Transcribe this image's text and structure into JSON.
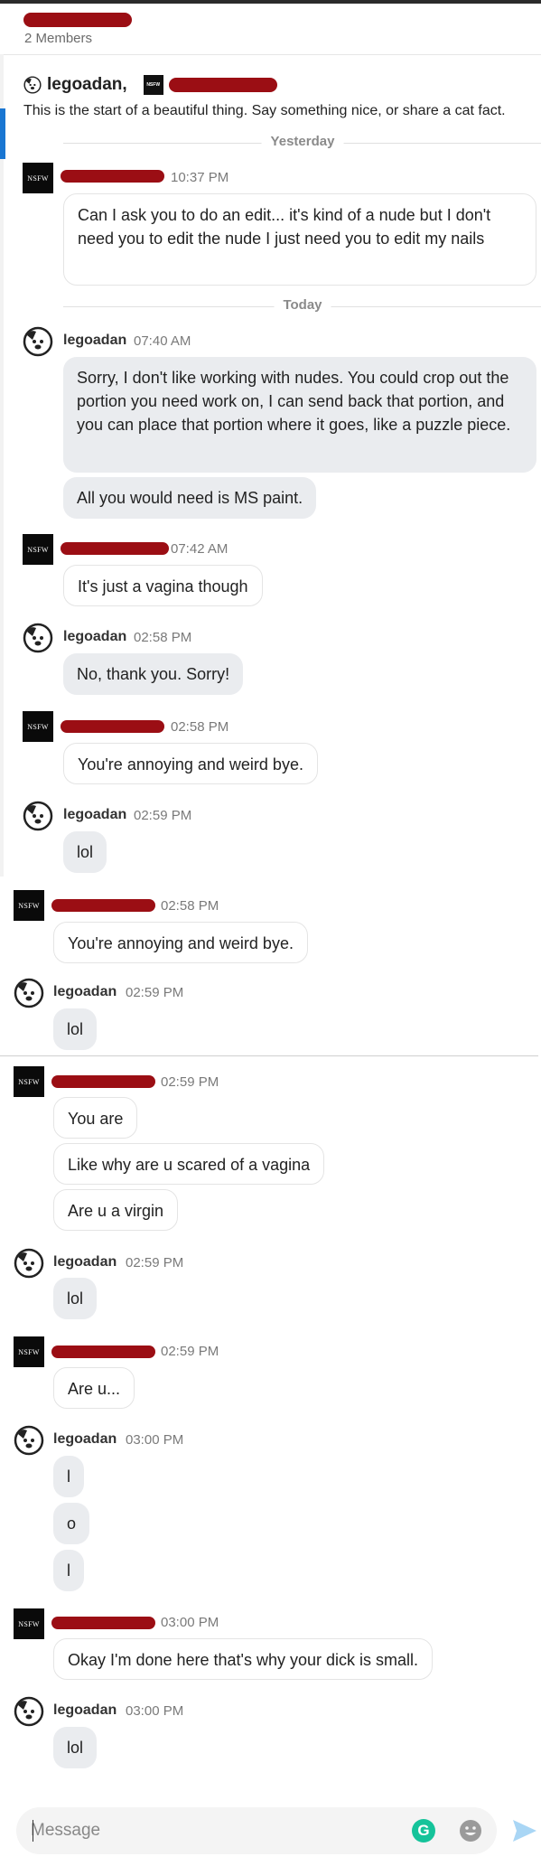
{
  "header": {
    "members": "2 Members",
    "intro_name_1": "legoadan,",
    "intro_text": "This is the start of a beautiful thing. Say something nice, or share a cat fact."
  },
  "icons": {
    "nsfw_avatar": "NSFW",
    "lego_avatar": "dog-face-icon",
    "grammarly": "G",
    "emoji": "emoji-icon",
    "send": "send-icon"
  },
  "dividers": {
    "yesterday": "Yesterday",
    "today": "Today"
  },
  "messages": {
    "m1": {
      "time": "10:37 PM",
      "text": "Can I ask you to do an edit... it's kind of a nude but I don't need you to edit the nude I just need you to edit my nails"
    },
    "m2": {
      "user": "legoadan",
      "time": "07:40 AM",
      "text1": "Sorry, I don't like working with nudes. You could crop out the portion you need work on, I can send back that portion, and you can place that portion where it goes, like a puzzle piece.",
      "text2": "All you would need is MS paint."
    },
    "m3": {
      "time": "07:42 AM",
      "text": "It's just a vagina though"
    },
    "m4": {
      "user": "legoadan",
      "time": "02:58 PM",
      "text": "No, thank you. Sorry!"
    },
    "m5": {
      "time": "02:58 PM",
      "text": "You're annoying and weird bye."
    },
    "m6": {
      "user": "legoadan",
      "time": "02:59 PM",
      "text": "lol"
    },
    "m7": {
      "time": "02:58 PM",
      "text": "You're annoying and weird bye."
    },
    "m8": {
      "user": "legoadan",
      "time": "02:59 PM",
      "text": "lol"
    },
    "m9": {
      "time": "02:59 PM",
      "text1": "You are",
      "text2": "Like why are u scared of a vagina",
      "text3": "Are u a virgin"
    },
    "m10": {
      "user": "legoadan",
      "time": "02:59 PM",
      "text": "lol"
    },
    "m11": {
      "time": "02:59 PM",
      "text": "Are u..."
    },
    "m12": {
      "user": "legoadan",
      "time": "03:00 PM",
      "text1": "l",
      "text2": "o",
      "text3": "l"
    },
    "m13": {
      "time": "03:00 PM",
      "text": "Okay I'm done here that's why your dick is small."
    },
    "m14": {
      "user": "legoadan",
      "time": "03:00 PM",
      "text": "lol"
    }
  },
  "composer": {
    "placeholder": "Message"
  },
  "colors": {
    "redaction": "#9b0e14",
    "accent_bar": "#1976d2",
    "grammarly": "#15c39a",
    "send": "#a9d6f5"
  }
}
